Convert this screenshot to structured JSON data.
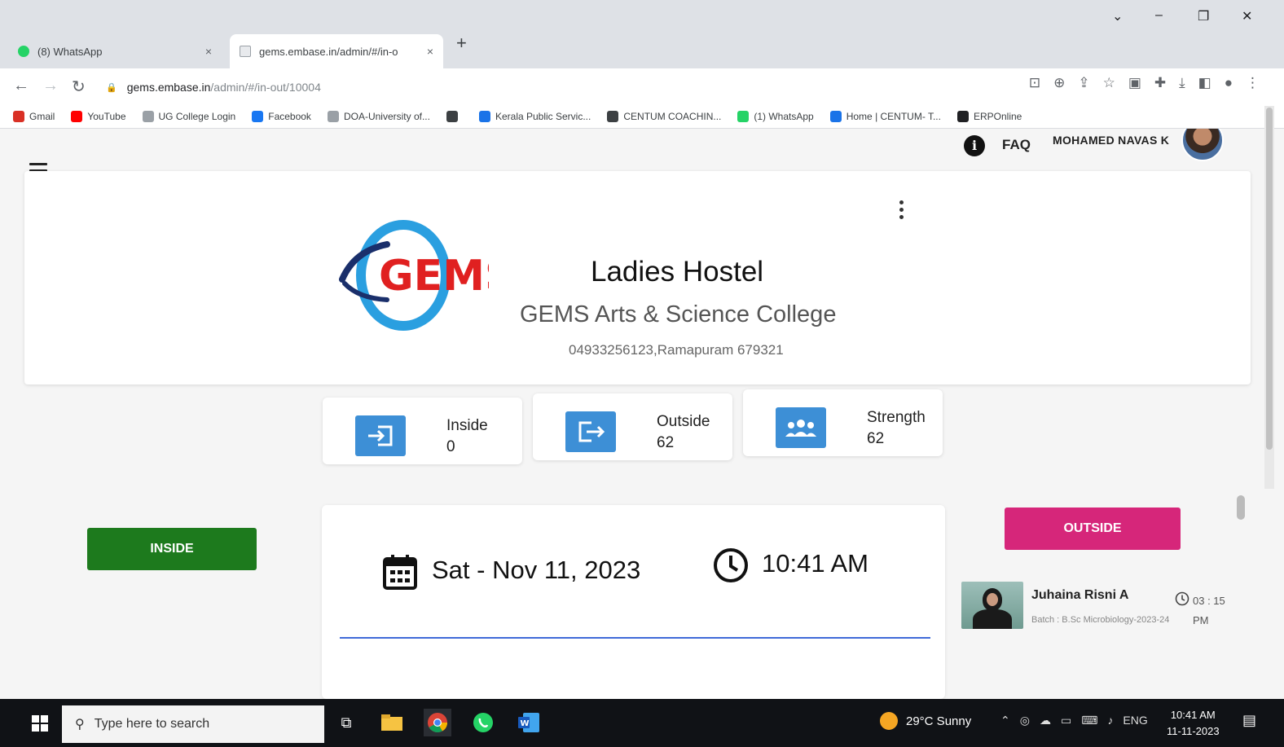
{
  "browser": {
    "tabs": [
      {
        "title": "(8) WhatsApp",
        "close": "×"
      },
      {
        "title": "gems.embase.in/admin/#/in-o",
        "close": "×"
      }
    ],
    "new_tab": "+",
    "window_controls": {
      "chevron": "⌄",
      "minimize": "–",
      "restore": "❐",
      "close": "✕"
    },
    "nav": {
      "back": "←",
      "forward": "→",
      "reload": "↻"
    },
    "url_host": "gems.embase.in",
    "url_path": "/admin/#/in-out/10004",
    "bookmarks": [
      {
        "label": "Gmail",
        "color": "#d93025"
      },
      {
        "label": "YouTube",
        "color": "#ff0000"
      },
      {
        "label": "UG College Login",
        "color": "#9aa0a6"
      },
      {
        "label": "Facebook",
        "color": "#1877f2"
      },
      {
        "label": "DOA-University of...",
        "color": "#9aa0a6"
      },
      {
        "label": "",
        "color": "#3c4043"
      },
      {
        "label": "Kerala Public Servic...",
        "color": "#1a73e8"
      },
      {
        "label": "CENTUM COACHIN...",
        "color": "#3c4043"
      },
      {
        "label": "(1) WhatsApp",
        "color": "#25d366"
      },
      {
        "label": "Home | CENTUM- T...",
        "color": "#1a73e8"
      },
      {
        "label": "ERPOnline",
        "color": "#202124"
      }
    ]
  },
  "app": {
    "faq": "FAQ",
    "info_glyph": "i",
    "user_name": "MOHAMED NAVAS K",
    "hostel_name": "Ladies Hostel",
    "college_name": "GEMS Arts & Science College",
    "contact": "04933256123,Ramapuram 679321",
    "logo_text": "GEMS",
    "stats": [
      {
        "label": "Inside",
        "value": "0",
        "icon": "login-icon"
      },
      {
        "label": "Outside",
        "value": "62",
        "icon": "logout-icon"
      },
      {
        "label": "Strength",
        "value": "62",
        "icon": "group-icon"
      }
    ],
    "inside_button": "INSIDE",
    "outside_button": "OUTSIDE",
    "date": "Sat - Nov 11, 2023",
    "time": "10:41 AM",
    "scan_input_value": "",
    "recent": {
      "name": "Juhaina Risni A",
      "batch": "Batch : B.Sc Microbiology-2023-24",
      "time": "03 : 15 PM"
    }
  },
  "taskbar": {
    "search_placeholder": "Type here to search",
    "weather": "29°C  Sunny",
    "lang": "ENG",
    "clock_time": "10:41 AM",
    "clock_date": "11-11-2023"
  },
  "colors": {
    "inside_green": "#1d7a1d",
    "outside_pink": "#d6267a",
    "stat_blue": "#3d8fd6",
    "input_underline": "#3f6ad8"
  }
}
